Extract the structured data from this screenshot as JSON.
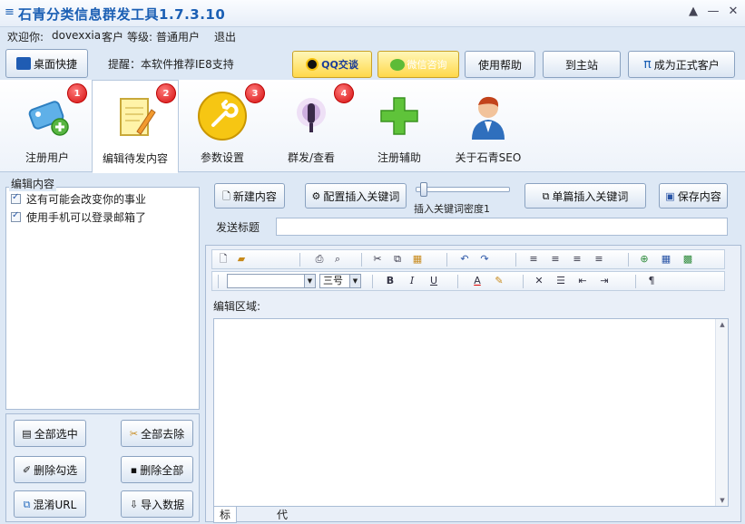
{
  "window": {
    "title": "石青分类信息群发工具1.7.3.10",
    "controls": {
      "help": "▲",
      "minimize": "—",
      "close": "✕"
    }
  },
  "userbar": {
    "welcome_prefix": "欢迎你:",
    "username": "dovexxia",
    "customer_suffix": "客户",
    "level_label": "等级:",
    "level_value": "普通用户",
    "logout": "退出"
  },
  "quickbar": {
    "desktop_shortcut": "桌面快捷",
    "tip": "提醒：本软件推荐IE8支持",
    "qq_chat": "QQ交谈",
    "wechat_consult": "微信咨询",
    "help": "使用帮助",
    "home_site": "到主站",
    "become_customer": "成为正式客户",
    "pi_glyph": "π"
  },
  "tabs": [
    {
      "label": "注册用户",
      "badge": "1"
    },
    {
      "label": "编辑待发内容",
      "badge": "2"
    },
    {
      "label": "参数设置",
      "badge": "3"
    },
    {
      "label": "群发/查看",
      "badge": "4"
    },
    {
      "label": "注册辅助",
      "badge": ""
    },
    {
      "label": "关于石青SEO",
      "badge": ""
    }
  ],
  "left_panel": {
    "group_title": "编辑内容",
    "items": [
      {
        "text": "这有可能会改变你的事业",
        "checked": true
      },
      {
        "text": "使用手机可以登录邮箱了",
        "checked": true
      }
    ],
    "buttons": {
      "select_all": "全部选中",
      "clear_all": "全部去除",
      "delete_checked": "删除勾选",
      "delete_all": "删除全部",
      "mix_url": "混淆URL",
      "import_data": "导入数据"
    }
  },
  "right_panel": {
    "new_content": "新建内容",
    "config_insert_keyword": "配置插入关键词",
    "slider_caption": "插入关键词密度1",
    "slider_value": 0.05,
    "single_insert_keyword": "单篇插入关键词",
    "save_content": "保存内容",
    "send_title_label": "发送标题",
    "send_title_value": "",
    "editor_label": "编辑区域:",
    "font_size_value": "三号",
    "font_name_value": "",
    "bottom_tabs": [
      "标准编辑",
      "代码编辑"
    ]
  },
  "colors": {
    "title_blue": "#1b5fb4",
    "badge_red": "#d40d0d",
    "accent_yellow": "#ffd84a"
  }
}
